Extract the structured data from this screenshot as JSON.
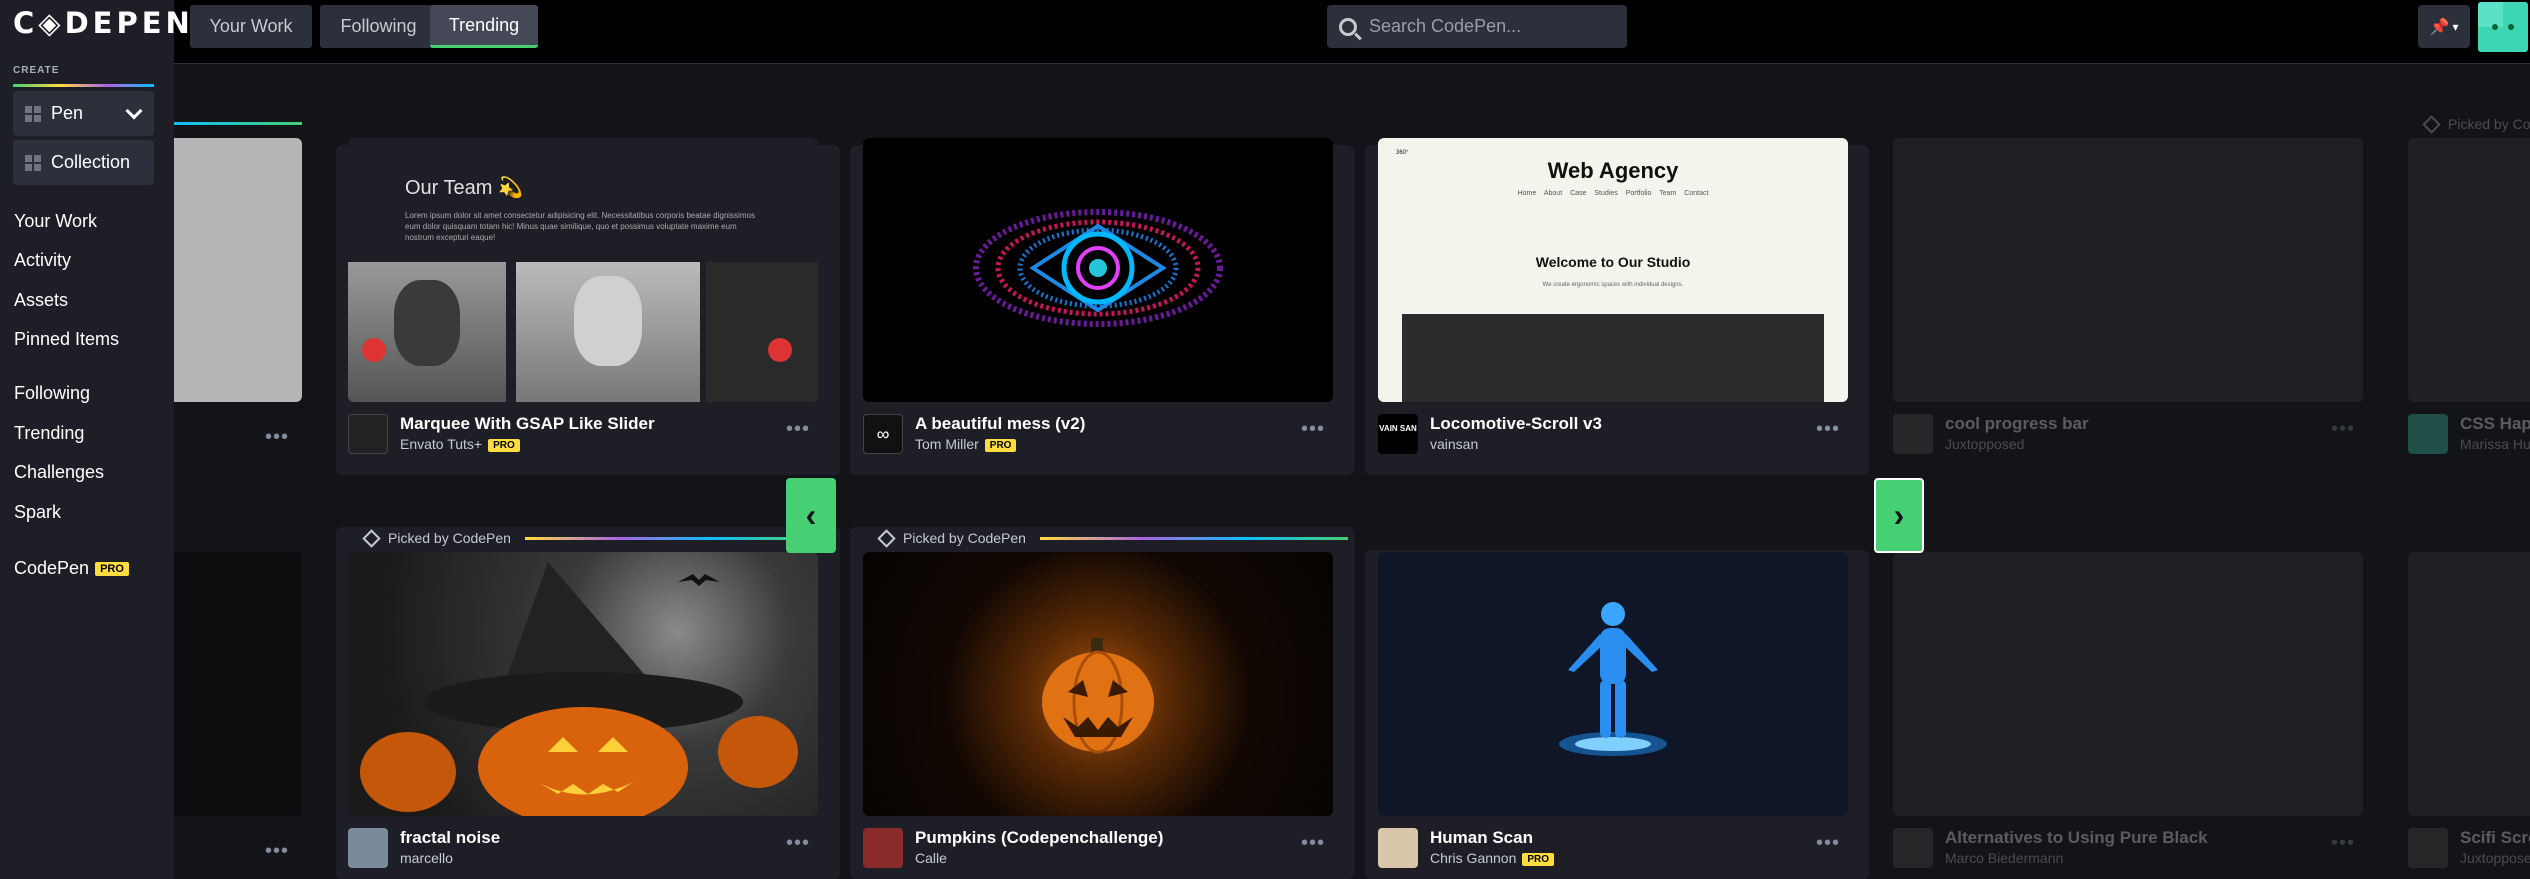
{
  "logo": "C◈DEPEN",
  "sidebar": {
    "create_label": "CREATE",
    "pen_label": "Pen",
    "collection_label": "Collection",
    "nav": [
      "Your Work",
      "Activity",
      "Assets",
      "Pinned Items",
      "Following",
      "Trending",
      "Challenges",
      "Spark"
    ],
    "codepen_label": "CodePen",
    "pro_badge": "PRO"
  },
  "header": {
    "tabs": [
      "Your Work",
      "Following",
      "Trending"
    ],
    "active_tab": "Trending",
    "search_placeholder": "Search CodePen..."
  },
  "picked_label": "Picked by CodePen",
  "picked_label_partial": "Picked by Co",
  "row1": [
    {
      "title": "Marquee With GSAP Like Slider",
      "author": "Envato Tuts+",
      "pro": "PRO"
    },
    {
      "title": "A beautiful mess (v2)",
      "author": "Tom Miller",
      "pro": "PRO"
    },
    {
      "title": "Locomotive-Scroll v3",
      "author": "vainsan"
    },
    {
      "title": "cool progress bar",
      "author": "Juxtopposed"
    },
    {
      "title": "CSS Happ",
      "author": "Marissa Hu"
    }
  ],
  "row2": [
    {
      "title": "fractal noise",
      "author": "marcello"
    },
    {
      "title": "Pumpkins (Codepenchallenge)",
      "author": "Calle"
    },
    {
      "title": "Human Scan",
      "author": "Chris Gannon",
      "pro": "PRO"
    },
    {
      "title": "Alternatives to Using Pure Black",
      "author": "Marco Biedermann"
    },
    {
      "title": "Scifi Scro",
      "author": "Juxtopposed"
    }
  ],
  "thumb_text": {
    "our_team": "Our Team 💫",
    "lorem": "Lorem ipsum dolor sit amet consectetur adipisicing elit. Necessitatibus corporis beatae dignissimos eum dolor quisquam totam hic! Minus quae similique, quo et possimus voluptate maxime eum nostrum excepturi eaque!",
    "web_agency": "Web Agency",
    "agency_nav": [
      "Home",
      "About",
      "Case Studies",
      "Portfolio",
      "Team",
      "Contact"
    ],
    "welcome": "Welcome to Our Studio",
    "welcome_sub": "We create ergonomic spaces with individual designs.",
    "vain_logo": "VAIN SAN",
    "agency_logo": "360°"
  },
  "more_label": "•••",
  "arrows": {
    "prev": "‹",
    "next": "›"
  }
}
